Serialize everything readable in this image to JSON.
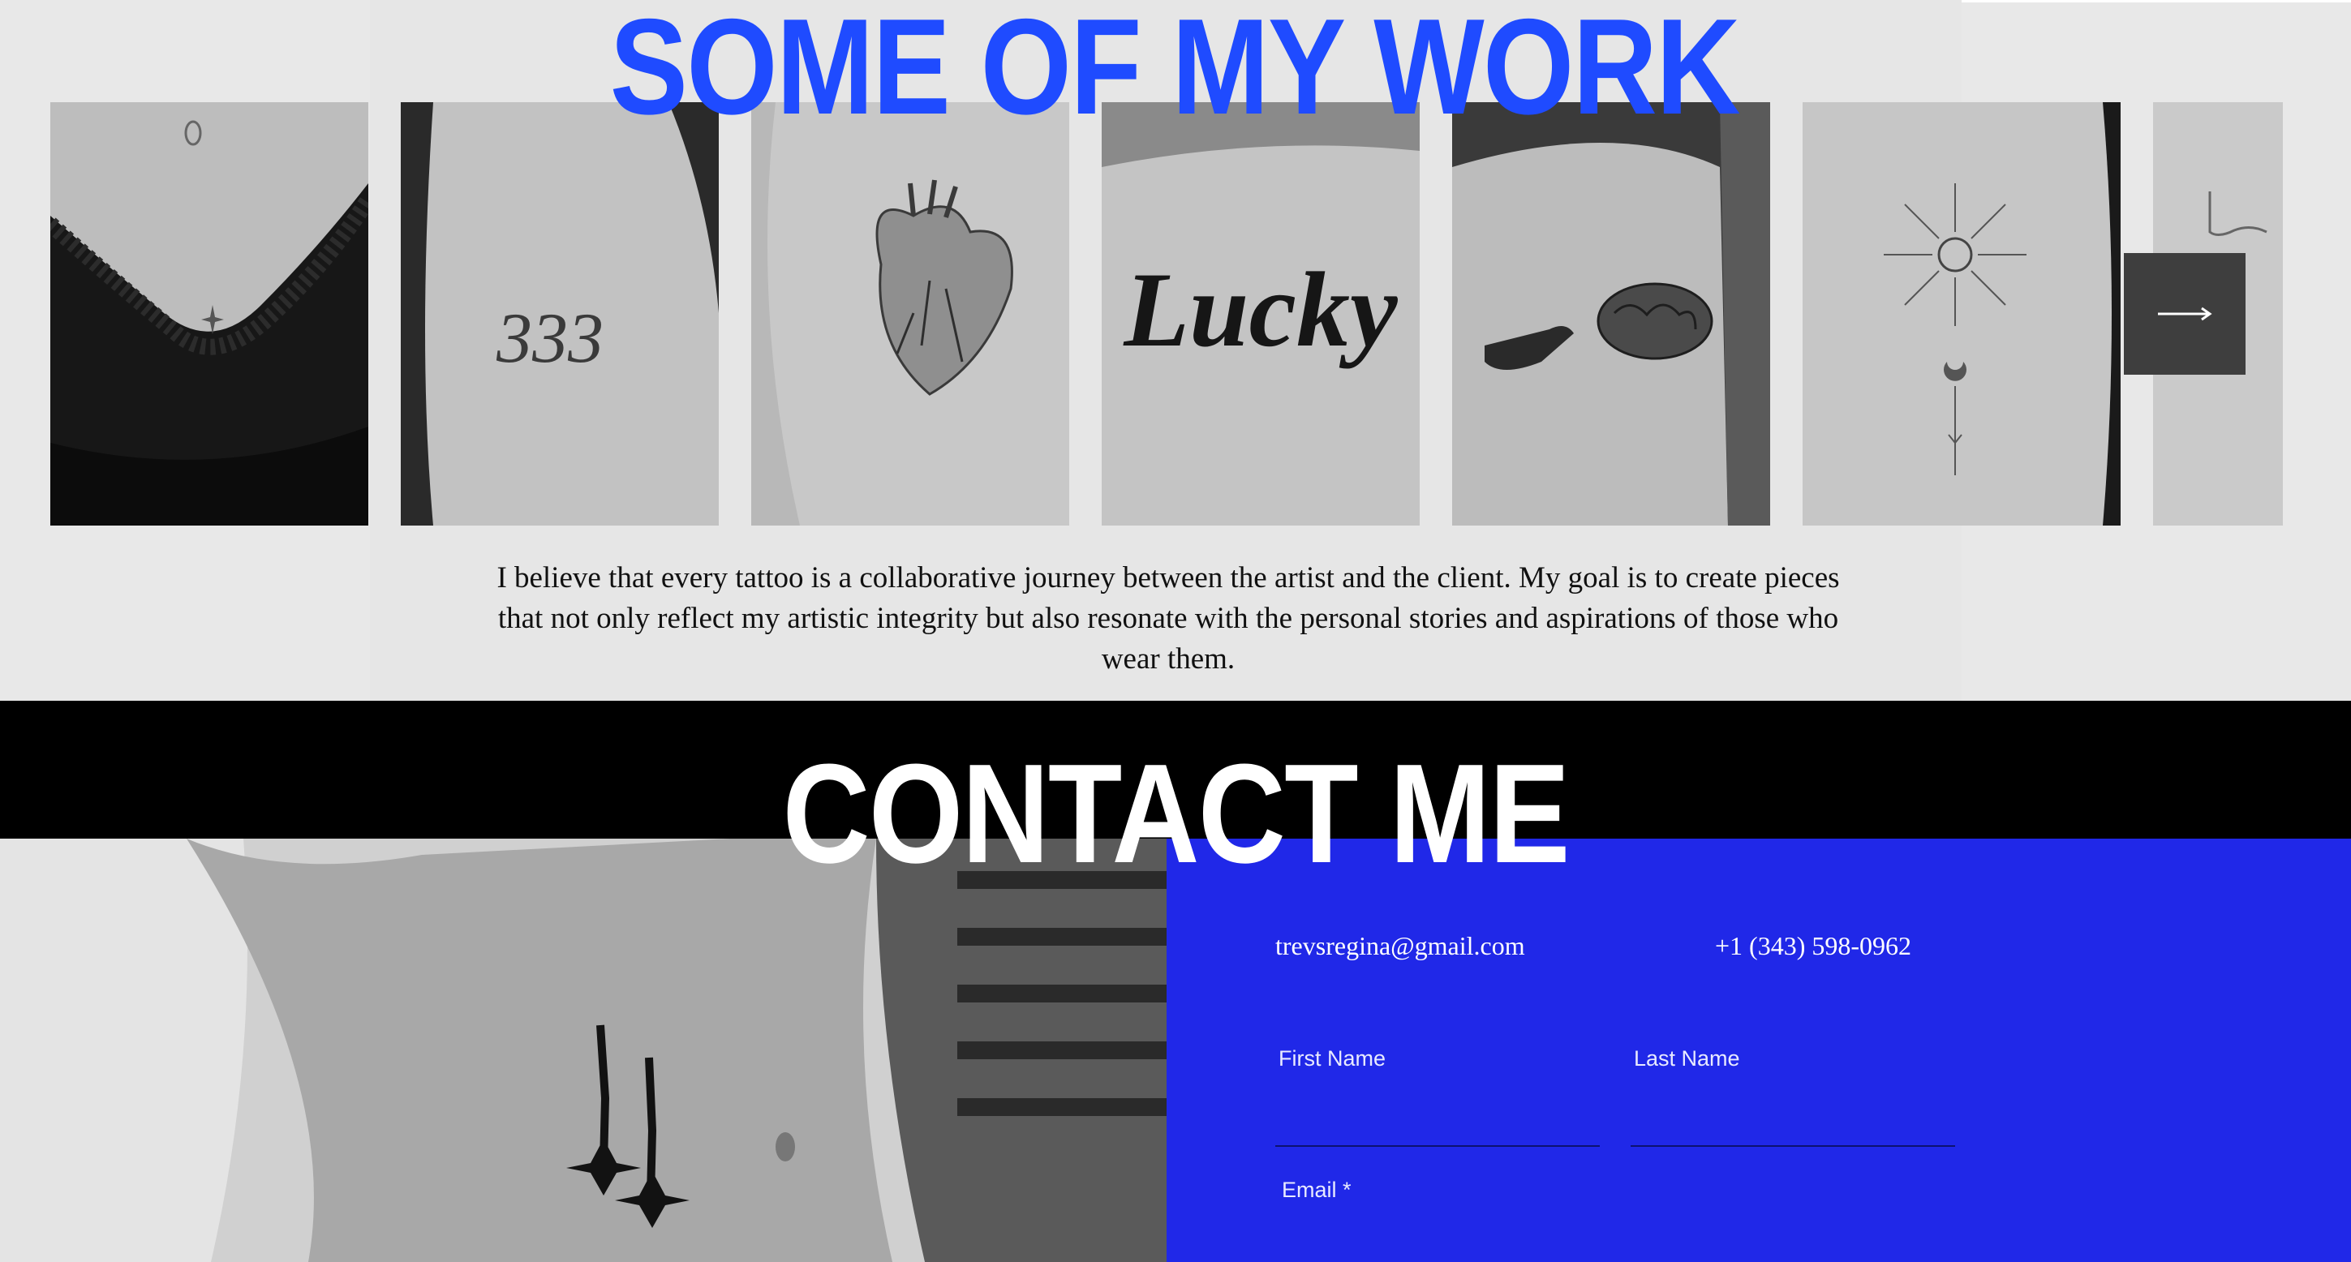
{
  "work": {
    "title": "SOME OF MY WORK",
    "description": "I believe that every tattoo is a collaborative journey between the artist and the client. My goal is to create pieces that not only reflect my artistic integrity but also resonate with the personal stories and aspirations of those who wear them.",
    "gallery": [
      {
        "name": "tattoo-star-navel",
        "tattoo_text": ""
      },
      {
        "name": "tattoo-333",
        "tattoo_text": "333"
      },
      {
        "name": "tattoo-anatomical-heart",
        "tattoo_text": ""
      },
      {
        "name": "tattoo-lucky-script",
        "tattoo_text": "Lucky"
      },
      {
        "name": "tattoo-hand-and-brain",
        "tattoo_text": ""
      },
      {
        "name": "tattoo-sun-moon",
        "tattoo_text": ""
      },
      {
        "name": "tattoo-script-partial",
        "tattoo_text": ""
      }
    ],
    "next_icon": "arrow-right-icon"
  },
  "contact": {
    "title": "CONTACT ME",
    "email": "trevsregina@gmail.com",
    "phone": "+1 (343) 598-0962",
    "form": {
      "first_name_label": "First Name",
      "last_name_label": "Last Name",
      "email_label": "Email *",
      "first_name_value": "",
      "last_name_value": "",
      "email_value": ""
    }
  },
  "colors": {
    "accent_blue": "#1f4bff",
    "contact_panel": "#2028e8",
    "band": "#000000",
    "background": "#e8e8e8"
  }
}
